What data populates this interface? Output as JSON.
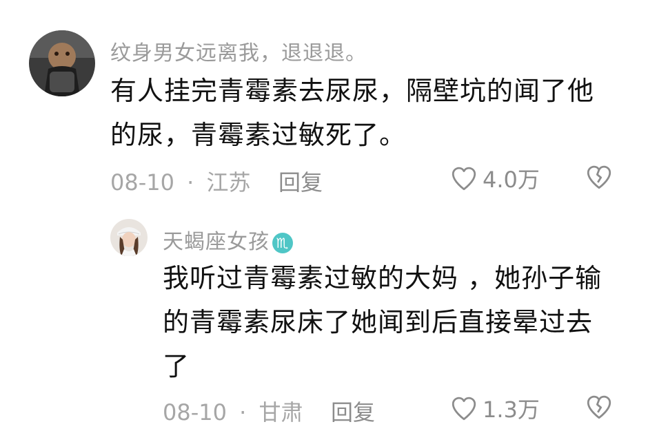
{
  "comments": [
    {
      "username": "纹身男女远离我，退退退。",
      "text_line1": "有人挂完青霉素去尿尿，隔壁坑的闻了他",
      "text_line2": "的尿，青霉素过敏死了。",
      "date": "08-10",
      "separator": "·",
      "location": "江苏",
      "reply_label": "回复",
      "likes": "4.0万"
    }
  ],
  "replies": [
    {
      "username": "天蝎座女孩",
      "zodiac_symbol": "♏",
      "text_line1": "我听过青霉素过敏的大妈 ，她孙子输",
      "text_line2": "的青霉素尿床了她闻到后直接晕过去",
      "text_line3": "了",
      "date": "08-10",
      "separator": "·",
      "location": "甘肃",
      "reply_label": "回复",
      "likes": "1.3万"
    }
  ],
  "icons": {
    "like": "heart-outline-icon",
    "dislike": "broken-heart-icon",
    "zodiac": "scorpio-icon"
  },
  "colors": {
    "username": "#9a9a9a",
    "meta": "#a6a6a6",
    "badge": "#4fc6c6"
  }
}
